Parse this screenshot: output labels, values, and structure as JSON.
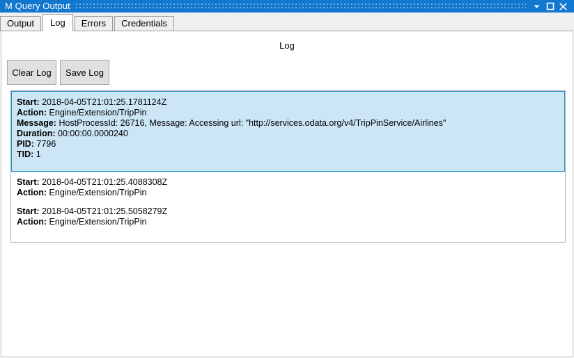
{
  "window": {
    "title": "M Query Output",
    "controls": [
      {
        "name": "minimize-dropdown-button",
        "glyph": "chevron-down-icon",
        "label": "▾"
      },
      {
        "name": "maximize-button",
        "glyph": "maximize-icon",
        "label": "□"
      },
      {
        "name": "close-button",
        "glyph": "close-icon",
        "label": "✕"
      }
    ]
  },
  "tabs": [
    {
      "label": "Output",
      "selected": false
    },
    {
      "label": "Log",
      "selected": true
    },
    {
      "label": "Errors",
      "selected": false
    },
    {
      "label": "Credentials",
      "selected": false
    }
  ],
  "panel": {
    "title": "Log",
    "buttons": [
      {
        "label": "Clear Log"
      },
      {
        "label": "Save Log"
      }
    ]
  },
  "log": {
    "entries": [
      {
        "selected": true,
        "fields": [
          {
            "label": "Start:",
            "value": "2018-04-05T21:01:25.1781124Z"
          },
          {
            "label": "Action:",
            "value": "Engine/Extension/TripPin"
          },
          {
            "label": "Message:",
            "value": "HostProcessId: 26716, Message: Accessing url: \"http://services.odata.org/v4/TripPinService/Airlines\""
          },
          {
            "label": "Duration:",
            "value": "00:00:00.0000240"
          },
          {
            "label": "PID:",
            "value": "7796"
          },
          {
            "label": "TID:",
            "value": "1"
          }
        ]
      },
      {
        "selected": false,
        "fields": [
          {
            "label": "Start:",
            "value": "2018-04-05T21:01:25.4088308Z"
          },
          {
            "label": "Action:",
            "value": "Engine/Extension/TripPin"
          }
        ]
      },
      {
        "selected": false,
        "fields": [
          {
            "label": "Start:",
            "value": "2018-04-05T21:01:25.5058279Z"
          },
          {
            "label": "Action:",
            "value": "Engine/Extension/TripPin"
          }
        ]
      }
    ]
  },
  "colors": {
    "titlebar": "#1277ce",
    "selection_fill": "#cce6f6",
    "selection_border": "#1f8ecd",
    "tab_background": "#f0f0f0",
    "button_face": "#e0e0e0"
  }
}
